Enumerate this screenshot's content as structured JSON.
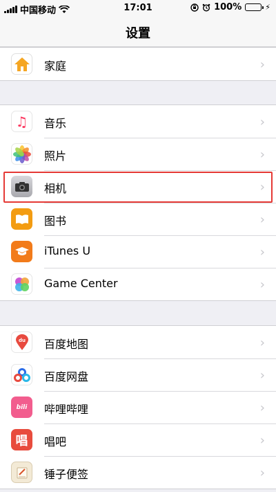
{
  "status": {
    "carrier": "中国移动",
    "time": "17:01",
    "battery": "100%",
    "battery_level": 1.0
  },
  "nav": {
    "title": "设置"
  },
  "groups": [
    {
      "items": [
        {
          "label": "家庭",
          "icon": "home-icon"
        }
      ]
    },
    {
      "items": [
        {
          "label": "音乐",
          "icon": "music-icon"
        },
        {
          "label": "照片",
          "icon": "photos-icon"
        },
        {
          "label": "相机",
          "icon": "camera-icon",
          "highlighted": true
        },
        {
          "label": "图书",
          "icon": "books-icon"
        },
        {
          "label": "iTunes U",
          "icon": "itunes-u-icon"
        },
        {
          "label": "Game Center",
          "icon": "game-center-icon"
        }
      ]
    },
    {
      "items": [
        {
          "label": "百度地图",
          "icon": "baidu-map-icon"
        },
        {
          "label": "百度网盘",
          "icon": "baidu-netdisk-icon"
        },
        {
          "label": "哔哩哔哩",
          "icon": "bilibili-icon"
        },
        {
          "label": "唱吧",
          "icon": "changba-icon"
        },
        {
          "label": "锤子便签",
          "icon": "smartisan-notes-icon"
        }
      ]
    }
  ],
  "colors": {
    "highlight": "#e53935",
    "home": "#f5a623",
    "books": "#f39c12",
    "itunes_u": "#f27b1a",
    "baidu_map": "#e84a3f",
    "baidu_netdisk": "#2b6de8",
    "bilibili": "#f25d8e",
    "changba": "#e84c3d"
  }
}
